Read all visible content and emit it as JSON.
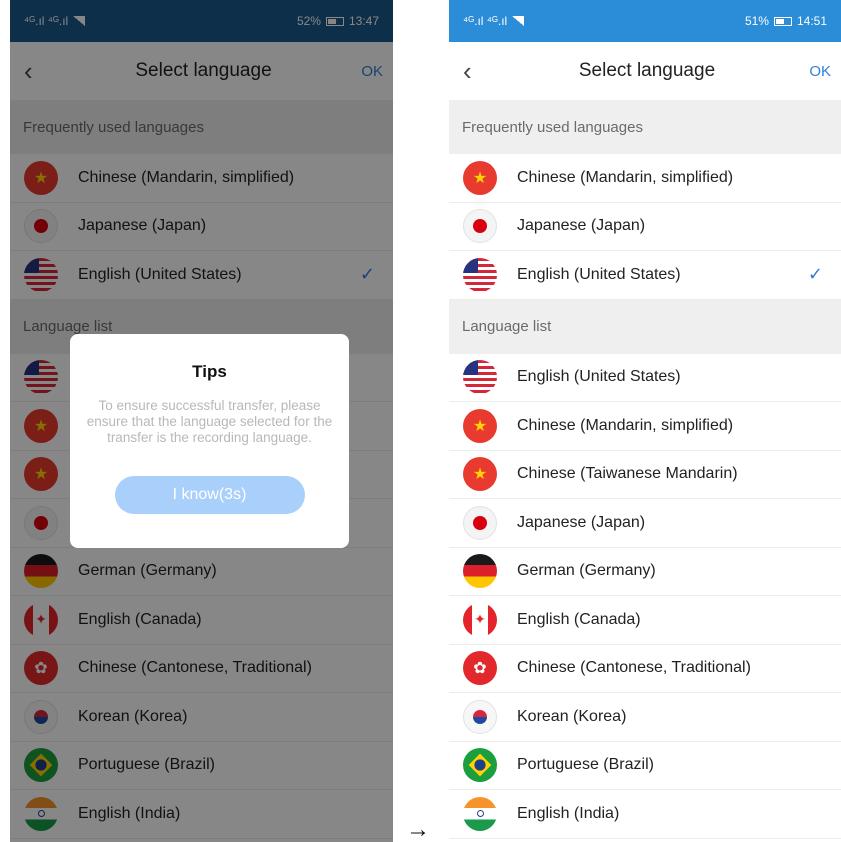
{
  "left": {
    "status": {
      "carrier": "⁴ᴳ.ıl ⁴ᴳ.ıl",
      "battery": "52%",
      "time": "13:47"
    },
    "nav": {
      "back": "‹",
      "title": "Select language",
      "ok": "OK"
    },
    "sections": {
      "frequent": "Frequently used languages",
      "list": "Language list"
    },
    "frequent": [
      {
        "label": "Chinese (Mandarin, simplified)",
        "flag": "cn"
      },
      {
        "label": "Japanese (Japan)",
        "flag": "jp"
      },
      {
        "label": "English (United States)",
        "flag": "us",
        "checked": true
      }
    ],
    "list": [
      {
        "label": "English (United States)",
        "flag": "us"
      },
      {
        "label": "Chinese (Mandarin, simplified)",
        "flag": "cn"
      },
      {
        "label": "Chinese (Taiwanese Mandarin)",
        "flag": "cn"
      },
      {
        "label": "Japanese (Japan)",
        "flag": "jp"
      },
      {
        "label": "German (Germany)",
        "flag": "de"
      },
      {
        "label": "English (Canada)",
        "flag": "ca"
      },
      {
        "label": "Chinese (Cantonese, Traditional)",
        "flag": "hk"
      },
      {
        "label": "Korean (Korea)",
        "flag": "kr"
      },
      {
        "label": "Portuguese (Brazil)",
        "flag": "br"
      },
      {
        "label": "English (India)",
        "flag": "in"
      }
    ],
    "dialog": {
      "title": "Tips",
      "message": "To ensure successful transfer, please ensure that the language selected for the transfer is the recording language.",
      "button": "I know(3s)"
    }
  },
  "right": {
    "status": {
      "carrier": "⁴ᴳ.ıl ⁴ᴳ.ıl",
      "battery": "51%",
      "time": "14:51"
    },
    "nav": {
      "back": "‹",
      "title": "Select language",
      "ok": "OK"
    },
    "sections": {
      "frequent": "Frequently used languages",
      "list": "Language list"
    },
    "frequent": [
      {
        "label": "Chinese (Mandarin, simplified)",
        "flag": "cn"
      },
      {
        "label": "Japanese (Japan)",
        "flag": "jp"
      },
      {
        "label": "English (United States)",
        "flag": "us",
        "checked": true
      }
    ],
    "list": [
      {
        "label": "English (United States)",
        "flag": "us"
      },
      {
        "label": "Chinese (Mandarin, simplified)",
        "flag": "cn"
      },
      {
        "label": "Chinese (Taiwanese Mandarin)",
        "flag": "cn"
      },
      {
        "label": "Japanese (Japan)",
        "flag": "jp"
      },
      {
        "label": "German (Germany)",
        "flag": "de"
      },
      {
        "label": "English (Canada)",
        "flag": "ca"
      },
      {
        "label": "Chinese (Cantonese, Traditional)",
        "flag": "hk"
      },
      {
        "label": "Korean (Korea)",
        "flag": "kr"
      },
      {
        "label": "Portuguese (Brazil)",
        "flag": "br"
      },
      {
        "label": "English (India)",
        "flag": "in"
      }
    ]
  },
  "arrow": "→",
  "checkmark": "✓",
  "colors": {
    "accent": "#2e7fd9",
    "button_disabled": "#a9d0fb",
    "section_bg": "#efefef"
  }
}
